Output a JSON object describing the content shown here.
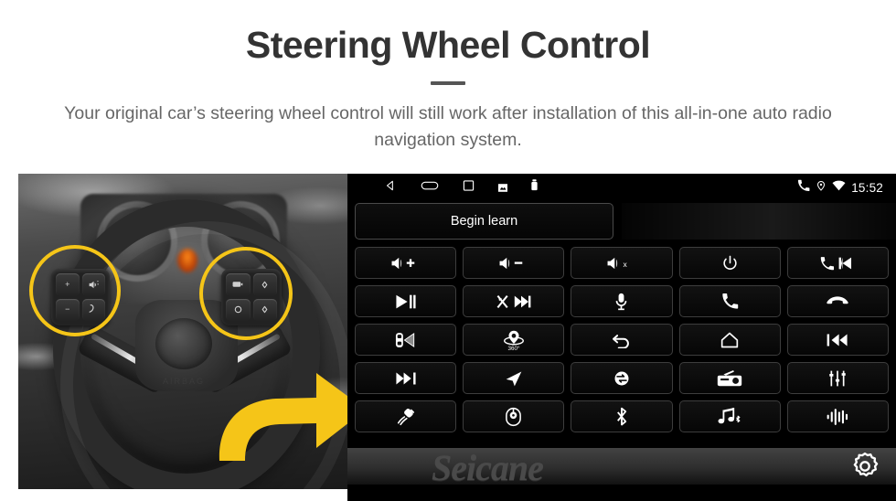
{
  "header": {
    "title": "Steering Wheel Control",
    "subtitle": "Your original car’s steering wheel control will still work after installation of this all-in-one auto radio navigation system."
  },
  "colors": {
    "accent_yellow": "#f5c518",
    "title_gray": "#333333",
    "subtitle_gray": "#666666",
    "panel_black": "#000000",
    "button_border": "#3d3d3d",
    "watermark_gray": "#4a4a4a"
  },
  "photo": {
    "alt": "grayscale-steering-wheel-photo",
    "airbag_text": "AIRBAG",
    "highlight_left": "left-steering-wheel-control-pad",
    "highlight_right": "right-steering-wheel-control-pad",
    "arrow": "yellow-right-arrow",
    "left_pad_keys": [
      "volume-up",
      "voice-command",
      "volume-down",
      "phone-call"
    ],
    "right_pad_keys": [
      "media-source",
      "up-arrow",
      "mode-circle",
      "down-arrow"
    ]
  },
  "unit": {
    "statusbar": {
      "nav": [
        {
          "name": "back-icon"
        },
        {
          "name": "home-icon"
        },
        {
          "name": "recents-icon"
        },
        {
          "name": "sdcard-icon"
        },
        {
          "name": "usb-icon"
        }
      ],
      "system": [
        {
          "name": "phone-icon"
        },
        {
          "name": "location-icon"
        },
        {
          "name": "wifi-icon"
        }
      ],
      "time": "15:52"
    },
    "begin_learn_label": "Begin learn",
    "watermark": "Seicane",
    "settings_icon": "gear-icon",
    "grid": [
      {
        "name": "volume-up-button",
        "icon": "volume-up",
        "label": "+"
      },
      {
        "name": "volume-down-button",
        "icon": "volume-down",
        "label": "−"
      },
      {
        "name": "mute-button",
        "icon": "volume-mute",
        "label": "x"
      },
      {
        "name": "power-button",
        "icon": "power",
        "label": ""
      },
      {
        "name": "call-previous-button",
        "icon": "phone-prev",
        "label": ""
      },
      {
        "name": "play-pause-button",
        "icon": "play-pause",
        "label": ""
      },
      {
        "name": "shuffle-next-button",
        "icon": "shuffle-next",
        "label": ""
      },
      {
        "name": "microphone-button",
        "icon": "microphone",
        "label": ""
      },
      {
        "name": "answer-call-button",
        "icon": "phone-answer",
        "label": ""
      },
      {
        "name": "end-call-button",
        "icon": "phone-hangup",
        "label": ""
      },
      {
        "name": "parking-radar-button",
        "icon": "car-radar",
        "label": ""
      },
      {
        "name": "camera-360-button",
        "icon": "camera-360",
        "label": "360°"
      },
      {
        "name": "back-button",
        "icon": "back-arrow",
        "label": ""
      },
      {
        "name": "home-button",
        "icon": "home",
        "label": ""
      },
      {
        "name": "previous-track-button",
        "icon": "previous-track",
        "label": ""
      },
      {
        "name": "next-track-button",
        "icon": "next-track",
        "label": ""
      },
      {
        "name": "navigation-button",
        "icon": "navigation-arrow",
        "label": ""
      },
      {
        "name": "source-switch-button",
        "icon": "source-switch",
        "label": ""
      },
      {
        "name": "radio-button",
        "icon": "radio",
        "label": ""
      },
      {
        "name": "equalizer-button",
        "icon": "equalizer",
        "label": ""
      },
      {
        "name": "usb-button",
        "icon": "usb-plug",
        "label": ""
      },
      {
        "name": "trackball-button",
        "icon": "trackball",
        "label": ""
      },
      {
        "name": "bluetooth-button",
        "icon": "bluetooth",
        "label": ""
      },
      {
        "name": "bluetooth-music-button",
        "icon": "bluetooth-music",
        "label": ""
      },
      {
        "name": "voice-assistant-button",
        "icon": "voice-waveform",
        "label": ""
      }
    ]
  }
}
